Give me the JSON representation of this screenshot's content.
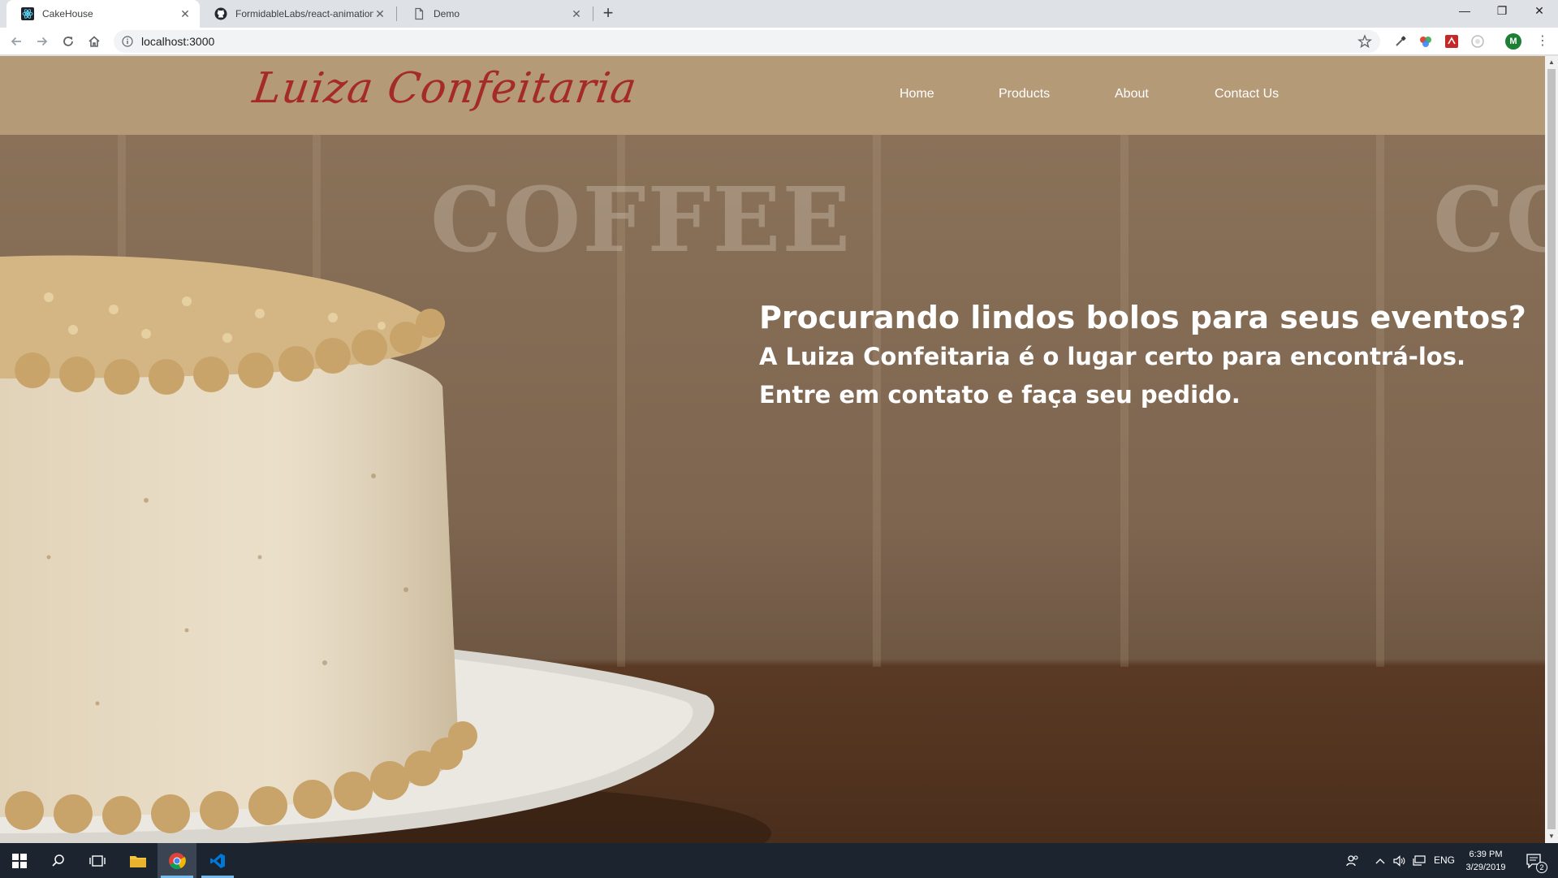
{
  "browser": {
    "tabs": [
      {
        "title": "CakeHouse",
        "icon": "react-icon",
        "active": true
      },
      {
        "title": "FormidableLabs/react-animation",
        "icon": "github-icon",
        "active": false
      },
      {
        "title": "Demo",
        "icon": "page-icon",
        "active": false
      }
    ],
    "new_tab_symbol": "+",
    "url": "localhost:3000",
    "profile_initial": "M",
    "window_controls": {
      "minimize": "—",
      "restore": "❐",
      "close": "✕"
    }
  },
  "site": {
    "logo": "Luiza Confeitaria",
    "nav": [
      "Home",
      "Products",
      "About",
      "Contact Us"
    ],
    "hero": {
      "heading": "Procurando lindos bolos para seus eventos?",
      "line1": "A Luiza Confeitaria é o lugar certo para encontrá-los.",
      "line2": "Entre em contato e faça seu pedido."
    },
    "background_text": "COFFEE",
    "colors": {
      "header": "#b59a78",
      "logo": "#a52a2a"
    }
  },
  "taskbar": {
    "language": "ENG",
    "time": "6:39 PM",
    "date": "3/29/2019",
    "notification_count": "2"
  }
}
